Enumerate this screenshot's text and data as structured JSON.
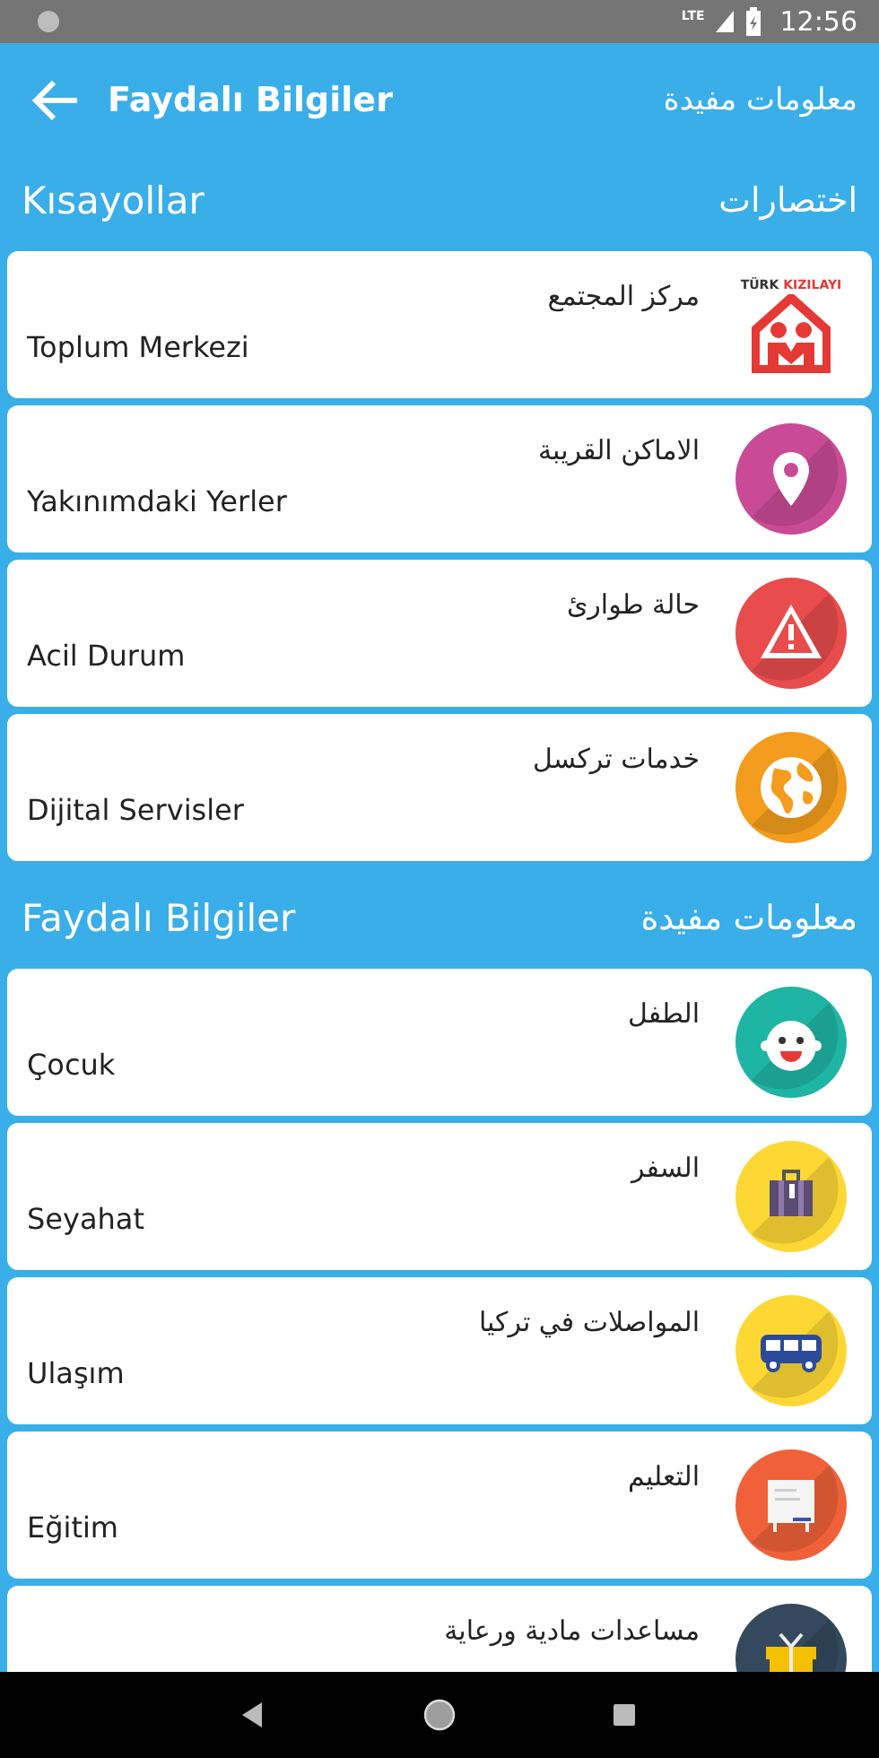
{
  "status_bar": {
    "network": "LTE",
    "time": "12:56"
  },
  "app_bar": {
    "title": "Faydalı Bilgiler",
    "title_arabic": "معلومات مفيدة"
  },
  "sections": [
    {
      "title": "Kısayollar",
      "title_arabic": "اختصارات",
      "items": [
        {
          "arabic": "مركز المجتمع",
          "label": "Toplum Merkezi",
          "kind": "logo",
          "logo_word_dark": "TÜRK",
          "logo_word_red": "KIZILAYI"
        },
        {
          "arabic": "الاماكن القريبة",
          "label": "Yakınımdaki Yerler",
          "kind": "pin",
          "color": "#c94b96"
        },
        {
          "arabic": "حالة طوارئ",
          "label": "Acil Durum",
          "kind": "warning",
          "color": "#e84c4c"
        },
        {
          "arabic": "خدمات تركسل",
          "label": "Dijital Servisler",
          "kind": "globe",
          "color": "#f39c1d"
        }
      ]
    },
    {
      "title": "Faydalı Bilgiler",
      "title_arabic": "معلومات مفيدة",
      "items": [
        {
          "arabic": "الطفل",
          "label": "Çocuk",
          "kind": "child",
          "color": "#1fb5a4"
        },
        {
          "arabic": "السفر",
          "label": "Seyahat",
          "kind": "luggage",
          "color": "#fdd835"
        },
        {
          "arabic": "المواصلات في تركيا",
          "label": "Ulaşım",
          "kind": "bus",
          "color": "#fdd835"
        },
        {
          "arabic": "التعليم",
          "label": "Eğitim",
          "kind": "board",
          "color": "#f0613a"
        },
        {
          "arabic": "مساعدات مادية ورعاية",
          "kind": "gift",
          "color": "#34495e"
        }
      ]
    }
  ]
}
